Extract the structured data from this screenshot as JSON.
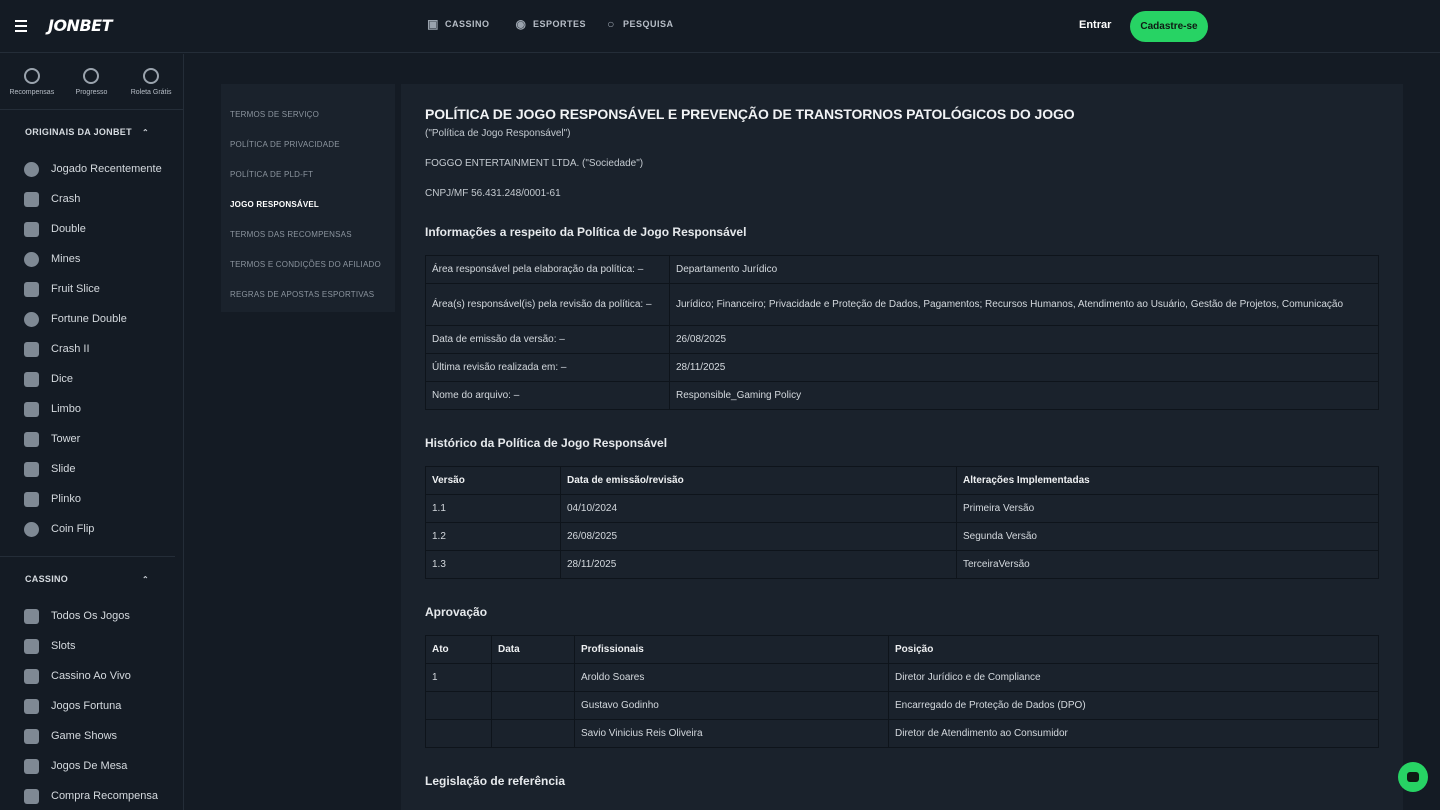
{
  "header": {
    "logo": "JONBET",
    "nav": [
      {
        "label": "CASSINO",
        "icon": "casino-icon"
      },
      {
        "label": "ESPORTES",
        "icon": "sports-ball-icon"
      },
      {
        "label": "PESQUISA",
        "icon": "search-icon"
      }
    ],
    "login_label": "Entrar",
    "signup_label": "Cadastre-se",
    "accent_color": "#27d364"
  },
  "sidebar": {
    "quick": [
      {
        "label": "Recompensas",
        "icon": "rewards-icon"
      },
      {
        "label": "Progresso",
        "icon": "trophy-icon"
      },
      {
        "label": "Roleta Grátis",
        "icon": "roulette-icon"
      }
    ],
    "originals_title": "ORIGINAIS DA JONBET",
    "originals": [
      {
        "label": "Jogado Recentemente",
        "icon": "history-icon"
      },
      {
        "label": "Crash",
        "icon": "crash-icon"
      },
      {
        "label": "Double",
        "icon": "double-icon"
      },
      {
        "label": "Mines",
        "icon": "mines-icon"
      },
      {
        "label": "Fruit Slice",
        "icon": "fruit-slice-icon"
      },
      {
        "label": "Fortune Double",
        "icon": "fortune-double-icon"
      },
      {
        "label": "Crash II",
        "icon": "rocket-icon"
      },
      {
        "label": "Dice",
        "icon": "dice-icon"
      },
      {
        "label": "Limbo",
        "icon": "limbo-icon"
      },
      {
        "label": "Tower",
        "icon": "tower-icon"
      },
      {
        "label": "Slide",
        "icon": "slide-icon"
      },
      {
        "label": "Plinko",
        "icon": "plinko-icon"
      },
      {
        "label": "Coin Flip",
        "icon": "coin-flip-icon"
      }
    ],
    "casino_title": "CASSINO",
    "casino": [
      {
        "label": "Todos Os Jogos",
        "icon": "all-games-icon"
      },
      {
        "label": "Slots",
        "icon": "slots-icon"
      },
      {
        "label": "Cassino Ao Vivo",
        "icon": "live-casino-icon"
      },
      {
        "label": "Jogos Fortuna",
        "icon": "fortune-games-icon"
      },
      {
        "label": "Game Shows",
        "icon": "game-shows-icon"
      },
      {
        "label": "Jogos De Mesa",
        "icon": "table-games-icon"
      },
      {
        "label": "Compra Recompensa",
        "icon": "buy-reward-icon"
      }
    ]
  },
  "legal_nav": [
    {
      "label": "TERMOS DE SERVIÇO",
      "active": false
    },
    {
      "label": "POLÍTICA DE PRIVACIDADE",
      "active": false
    },
    {
      "label": "POLÍTICA DE PLD-FT",
      "active": false
    },
    {
      "label": "JOGO RESPONSÁVEL",
      "active": true
    },
    {
      "label": "TERMOS DAS RECOMPENSAS",
      "active": false
    },
    {
      "label": "TERMOS E CONDIÇÕES DO AFILIADO",
      "active": false
    },
    {
      "label": "REGRAS DE APOSTAS ESPORTIVAS",
      "active": false
    }
  ],
  "doc": {
    "title": "POLÍTICA DE JOGO RESPONSÁVEL E PREVENÇÃO DE TRANSTORNOS PATOLÓGICOS DO JOGO",
    "subtitle": "(\"Política de Jogo Responsável\")",
    "company": "FOGGO ENTERTAINMENT LTDA. (\"Sociedade\")",
    "cnpj": "CNPJ/MF 56.431.248/0001-61",
    "info_heading": "Informações a respeito da Política de Jogo Responsável",
    "info_rows": [
      [
        "Área responsável pela elaboração da política: –",
        "Departamento Jurídico"
      ],
      [
        "Área(s) responsável(is) pela revisão da política: –",
        "Jurídico; Financeiro; Privacidade e Proteção de Dados, Pagamentos; Recursos Humanos, Atendimento ao Usuário, Gestão de Projetos, Comunicação"
      ],
      [
        "Data de emissão da versão: –",
        "26/08/2025"
      ],
      [
        "Última revisão realizada em: –",
        "28/11/2025"
      ],
      [
        "Nome do arquivo: –",
        "Responsible_Gaming Policy"
      ]
    ],
    "history_heading": "Histórico da Política de Jogo Responsável",
    "history_headers": [
      "Versão",
      "Data de emissão/revisão",
      "Alterações Implementadas"
    ],
    "history_rows": [
      [
        "1.1",
        "04/10/2024",
        "Primeira Versão"
      ],
      [
        "1.2",
        "26/08/2025",
        "Segunda Versão"
      ],
      [
        "1.3",
        "28/11/2025",
        "TerceiraVersão"
      ]
    ],
    "approval_heading": "Aprovação",
    "approval_headers": [
      "Ato",
      "Data",
      "Profissionais",
      "Posição"
    ],
    "approval_rows": [
      [
        "1",
        "",
        "Aroldo Soares",
        "Diretor Jurídico e de Compliance"
      ],
      [
        "",
        "",
        "Gustavo Godinho",
        "Encarregado de Proteção de Dados (DPO)"
      ],
      [
        "",
        "",
        "Savio Vinicius Reis Oliveira",
        "Diretor de Atendimento ao Consumidor"
      ]
    ],
    "legislation_heading": "Legislação de referência"
  }
}
